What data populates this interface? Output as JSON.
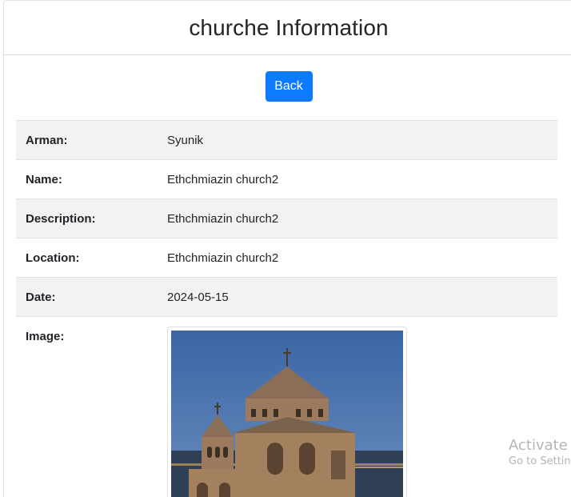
{
  "header": {
    "title": "churche Information"
  },
  "actions": {
    "back_label": "Back"
  },
  "details": {
    "rows": [
      {
        "label": "Arman:",
        "value": "Syunik"
      },
      {
        "label": "Name:",
        "value": "Ethchmiazin church2"
      },
      {
        "label": "Description:",
        "value": "Ethchmiazin church2"
      },
      {
        "label": "Location:",
        "value": "Ethchmiazin church2"
      },
      {
        "label": "Date:",
        "value": "2024-05-15"
      }
    ],
    "image_label": "Image:"
  },
  "overlay": {
    "activate_title": "Activate W",
    "activate_sub": "Go to Settin"
  },
  "colors": {
    "primary": "#0d7bff",
    "stripe": "#f2f2f2",
    "sky": "#3e6aa8"
  }
}
